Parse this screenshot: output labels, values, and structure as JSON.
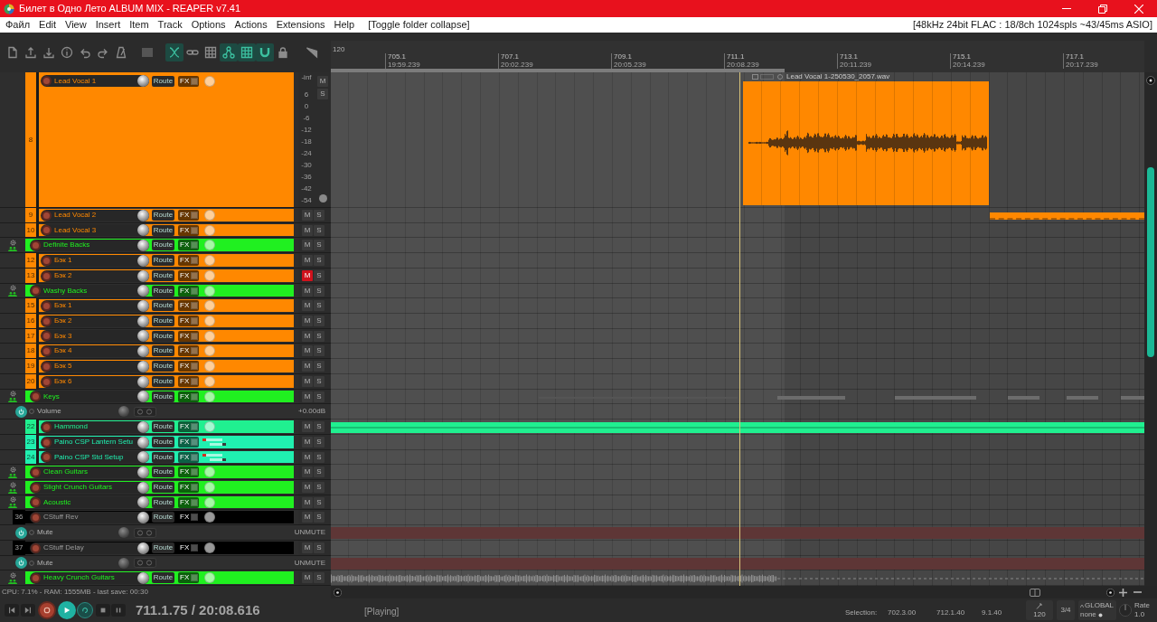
{
  "window": {
    "title": "Билет в Одно Лето ALBUM MIX - REAPER v7.41"
  },
  "menu": {
    "items": [
      "Файл",
      "Edit",
      "View",
      "Insert",
      "Item",
      "Track",
      "Options",
      "Actions",
      "Extensions",
      "Help"
    ],
    "action_hint": "[Toggle folder collapse]",
    "audio_status": "[48kHz 24bit FLAC : 18/8ch 1024spls ~43/45ms ASIO]"
  },
  "toolbar": [
    [
      {
        "kind": "new",
        "on": false
      },
      {
        "kind": "open",
        "on": false
      },
      {
        "kind": "save",
        "on": false
      },
      {
        "kind": "info",
        "on": false
      },
      {
        "kind": "undo",
        "on": false
      },
      {
        "kind": "redo",
        "on": false
      },
      {
        "kind": "metronome",
        "on": false
      }
    ],
    [
      {
        "kind": "square",
        "on": false
      }
    ],
    [
      {
        "kind": "ripple",
        "on": true
      },
      {
        "kind": "link",
        "on": false
      },
      {
        "kind": "grid",
        "on": false
      },
      {
        "kind": "nodes",
        "on": true
      },
      {
        "kind": "grid",
        "on": true
      },
      {
        "kind": "magnet",
        "on": true
      },
      {
        "kind": "lock",
        "on": false
      }
    ],
    [
      {
        "kind": "wedge",
        "on": false
      }
    ]
  ],
  "ruler": {
    "tempo": "120",
    "markers": [
      {
        "bar": "705.1",
        "time": "19:59.239"
      },
      {
        "bar": "707.1",
        "time": "20:02.239"
      },
      {
        "bar": "709.1",
        "time": "20:05.239"
      },
      {
        "bar": "711.1",
        "time": "20:08.239"
      },
      {
        "bar": "713.1",
        "time": "20:11.239"
      },
      {
        "bar": "715.1",
        "time": "20:14.239"
      },
      {
        "bar": "717.1",
        "time": "20:17.239"
      }
    ]
  },
  "tracks": [
    {
      "kind": "group",
      "children": [
        {
          "kind": "tall",
          "number": "8",
          "name": "Lead Vocal 1",
          "color": "#ff8800",
          "folder": false,
          "muted": false,
          "route_button": "Route",
          "fx_button": "FX",
          "mute_button": "M",
          "solo_button": "S",
          "pan": {
            "kind": "knob"
          },
          "meter_scale": [
            "-inf",
            "6",
            "0",
            "-6",
            "-12",
            "-18",
            "-24",
            "-30",
            "-36",
            "-42",
            "-54"
          ],
          "items": [
            {
              "kind": "audio",
              "label": "Lead Vocal 1-250530_2057.wav"
            }
          ]
        },
        {
          "kind": "track",
          "number": "9",
          "name": "Lead Vocal 2",
          "color": "#ff8800",
          "folder": false,
          "muted": false,
          "route_button": "Route",
          "fx_button": "FX",
          "mute_button": "M",
          "solo_button": "S",
          "pan": {
            "kind": "knob"
          },
          "items": [
            {
              "kind": "clip"
            }
          ]
        },
        {
          "kind": "track",
          "number": "10",
          "name": "Lead Vocal 3",
          "color": "#ff8800",
          "folder": false,
          "muted": false,
          "route_button": "Route",
          "fx_button": "FX",
          "mute_button": "M",
          "solo_button": "S",
          "pan": {
            "kind": "knob"
          }
        }
      ]
    },
    {
      "kind": "track",
      "name": "Definite Backs",
      "color": "#20f020",
      "folder": true,
      "muted": false,
      "route_button": "Route",
      "fx_button": "FX",
      "mute_button": "M",
      "solo_button": "S",
      "pan": {
        "kind": "knob"
      },
      "children": [
        {
          "kind": "track",
          "number": "12",
          "name": "Бэк 1",
          "color": "#ff8800",
          "folder": false,
          "muted": false,
          "route_button": "Route",
          "fx_button": "FX",
          "mute_button": "M",
          "solo_button": "S",
          "pan": {
            "kind": "knob"
          }
        },
        {
          "kind": "track",
          "number": "13",
          "name": "Бэк 2",
          "color": "#ff8800",
          "folder": false,
          "muted": true,
          "route_button": "Route",
          "fx_button": "FX",
          "mute_button": "M",
          "solo_button": "S",
          "pan": {
            "kind": "knob"
          }
        }
      ]
    },
    {
      "kind": "track",
      "name": "Washy Backs",
      "color": "#20f020",
      "folder": true,
      "muted": false,
      "route_button": "Route",
      "fx_button": "FX",
      "mute_button": "M",
      "solo_button": "S",
      "pan": {
        "kind": "knob"
      },
      "children": [
        {
          "kind": "track",
          "number": "15",
          "name": "Бэк 1",
          "color": "#ff8800",
          "folder": false,
          "muted": false,
          "route_button": "Route",
          "fx_button": "FX",
          "mute_button": "M",
          "solo_button": "S",
          "pan": {
            "kind": "knob"
          }
        },
        {
          "kind": "track",
          "number": "16",
          "name": "Бэк 2",
          "color": "#ff8800",
          "folder": false,
          "muted": false,
          "route_button": "Route",
          "fx_button": "FX",
          "mute_button": "M",
          "solo_button": "S",
          "pan": {
            "kind": "knob"
          }
        },
        {
          "kind": "track",
          "number": "17",
          "name": "Бэк 3",
          "color": "#ff8800",
          "folder": false,
          "muted": false,
          "route_button": "Route",
          "fx_button": "FX",
          "mute_button": "M",
          "solo_button": "S",
          "pan": {
            "kind": "knob"
          }
        },
        {
          "kind": "track",
          "number": "18",
          "name": "Бэк 4",
          "color": "#ff8800",
          "folder": false,
          "muted": false,
          "route_button": "Route",
          "fx_button": "FX",
          "mute_button": "M",
          "solo_button": "S",
          "pan": {
            "kind": "knob"
          }
        },
        {
          "kind": "track",
          "number": "19",
          "name": "Бэк 5",
          "color": "#ff8800",
          "folder": false,
          "muted": false,
          "route_button": "Route",
          "fx_button": "FX",
          "mute_button": "M",
          "solo_button": "S",
          "pan": {
            "kind": "knob"
          }
        },
        {
          "kind": "track",
          "number": "20",
          "name": "Бэк 6",
          "color": "#ff8800",
          "folder": false,
          "muted": false,
          "route_button": "Route",
          "fx_button": "FX",
          "mute_button": "M",
          "solo_button": "S",
          "pan": {
            "kind": "knob"
          }
        }
      ]
    },
    {
      "kind": "track",
      "name": "Keys",
      "color": "#20f020",
      "folder": true,
      "muted": false,
      "route_button": "Route",
      "fx_button": "FX",
      "mute_button": "M",
      "solo_button": "S",
      "pan": {
        "kind": "knob"
      },
      "items": [
        {
          "kind": "midi"
        }
      ],
      "envelopes": [
        {
          "name": "Volume",
          "value": "+0.00dB"
        }
      ],
      "children": [
        {
          "kind": "track",
          "number": "22",
          "name": "Hammond",
          "color": "#20f090",
          "folder": false,
          "muted": false,
          "route_button": "Route",
          "fx_button": "FX",
          "mute_button": "M",
          "solo_button": "S",
          "pan": {
            "kind": "knob"
          },
          "items": [
            {
              "kind": "midi_bar"
            }
          ]
        },
        {
          "kind": "track",
          "number": "23",
          "name": "Paino CSP Lantern Setu",
          "color": "#20f0b0",
          "folder": false,
          "muted": false,
          "route_button": "Route",
          "fx_button": "FX",
          "mute_button": "M",
          "solo_button": "S",
          "pan": {
            "kind": "dual"
          }
        },
        {
          "kind": "track",
          "number": "24",
          "name": "Paino CSP Std Setup",
          "color": "#20f0b0",
          "folder": false,
          "muted": false,
          "route_button": "Route",
          "fx_button": "FX",
          "mute_button": "M",
          "solo_button": "S",
          "pan": {
            "kind": "dual"
          }
        }
      ]
    },
    {
      "kind": "track",
      "name": "Clean Guitars",
      "color": "#20f020",
      "folder": true,
      "muted": false,
      "route_button": "Route",
      "fx_button": "FX",
      "mute_button": "M",
      "solo_button": "S",
      "pan": {
        "kind": "knob"
      }
    },
    {
      "kind": "track",
      "name": "Slight Crunch Guitars",
      "color": "#20f020",
      "folder": true,
      "muted": false,
      "route_button": "Route",
      "fx_button": "FX",
      "mute_button": "M",
      "solo_button": "S",
      "pan": {
        "kind": "knob"
      }
    },
    {
      "kind": "track",
      "name": "Acoustic",
      "color": "#20f020",
      "folder": true,
      "muted": false,
      "route_button": "Route",
      "fx_button": "FX",
      "mute_button": "M",
      "solo_button": "S",
      "pan": {
        "kind": "knob"
      }
    },
    {
      "kind": "track",
      "number": "36",
      "name": "CStuff Rev",
      "color": "#000000",
      "folder": false,
      "muted": false,
      "route_button": "Route",
      "fx_button": "FX",
      "mute_button": "M",
      "solo_button": "S",
      "pan": {
        "kind": "knob"
      },
      "envelopes": [
        {
          "name": "Mute",
          "value": "UNMUTE",
          "items": [
            {
              "kind": "mute_band"
            }
          ]
        }
      ]
    },
    {
      "kind": "track",
      "number": "37",
      "name": "CStuff Delay",
      "color": "#000000",
      "folder": false,
      "muted": false,
      "route_button": "Route",
      "fx_button": "FX",
      "mute_button": "M",
      "solo_button": "S",
      "pan": {
        "kind": "knob"
      },
      "envelopes": [
        {
          "name": "Mute",
          "value": "UNMUTE",
          "items": [
            {
              "kind": "mute_band"
            }
          ]
        }
      ]
    },
    {
      "kind": "track",
      "name": "Heavy Crunch Guitars",
      "color": "#20f020",
      "folder": true,
      "muted": false,
      "route_button": "Route",
      "fx_button": "FX",
      "mute_button": "M",
      "solo_button": "S",
      "pan": {
        "kind": "knob"
      },
      "items": [
        {
          "kind": "waveform"
        }
      ]
    }
  ],
  "status_line": "CPU: 7.1% - RAM: 1555MB - last save: 00:30",
  "transport": {
    "buttons": [
      {
        "kind": "start",
        "on": false
      },
      {
        "kind": "end",
        "on": false
      },
      {
        "kind": "record",
        "on": false
      },
      {
        "kind": "play",
        "on": true
      },
      {
        "kind": "repeat",
        "on": true
      },
      {
        "kind": "stop",
        "on": false
      },
      {
        "kind": "pause",
        "on": false
      }
    ],
    "position": "711.1.75 / 20:08.616",
    "state": "[Playing]"
  },
  "selection": {
    "label": "Selection:",
    "start": "702.3.00",
    "end": "712.1.40",
    "length": "9.1.40"
  },
  "tempo": {
    "bpm": "120",
    "time_signature": "3/4",
    "mode": "GLOBAL",
    "mode_value": "none",
    "rate_label": "Rate",
    "rate": "1.0"
  }
}
